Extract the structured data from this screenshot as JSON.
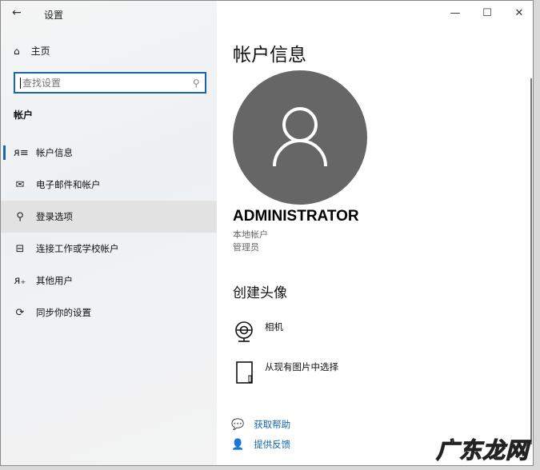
{
  "window": {
    "title": "设置",
    "back": "←",
    "minimize": "—",
    "maximize": "☐",
    "close": "✕"
  },
  "sidebar": {
    "home": "主页",
    "search_placeholder": "查找设置",
    "section": "帐户",
    "items": [
      {
        "label": "帐户信息",
        "icon": "account-info-icon"
      },
      {
        "label": "电子邮件和帐户",
        "icon": "mail-icon"
      },
      {
        "label": "登录选项",
        "icon": "key-icon"
      },
      {
        "label": "连接工作或学校帐户",
        "icon": "briefcase-icon"
      },
      {
        "label": "其他用户",
        "icon": "add-user-icon"
      },
      {
        "label": "同步你的设置",
        "icon": "sync-icon"
      }
    ]
  },
  "main": {
    "title": "帐户信息",
    "username": "ADMINISTRATOR",
    "account_type": "本地帐户",
    "role": "管理员",
    "create_avatar": "创建头像",
    "options": [
      {
        "label": "相机",
        "icon": "camera-icon"
      },
      {
        "label": "从现有图片中选择",
        "icon": "picture-file-icon"
      }
    ],
    "links": [
      {
        "label": "获取帮助",
        "icon": "help-icon"
      },
      {
        "label": "提供反馈",
        "icon": "feedback-icon"
      }
    ]
  },
  "watermark": "广东龙网",
  "colors": {
    "accent": "#1565b0",
    "avatar": "#666666"
  }
}
